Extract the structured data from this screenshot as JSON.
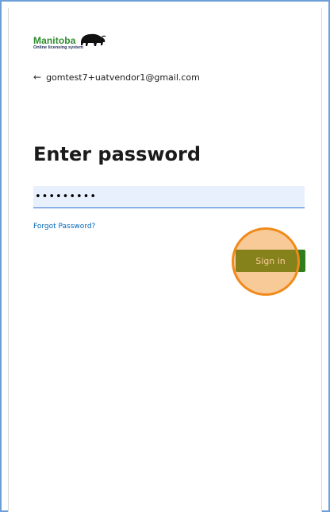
{
  "brand": {
    "name": "Manitoba",
    "tagline": "Online licensing system",
    "logo_icon": "bison-icon",
    "brand_color": "#2e8b2e"
  },
  "account": {
    "back_icon": "arrow-left-icon",
    "email": "gomtest7+uatvendor1@gmail.com"
  },
  "form": {
    "heading": "Enter password",
    "password_value": "•••••••••",
    "forgot_link": "Forgot Password?",
    "submit_label": "Sign in",
    "submit_color": "#2f7d1c"
  },
  "overlay": {
    "highlight_color": "#f08a1a"
  }
}
